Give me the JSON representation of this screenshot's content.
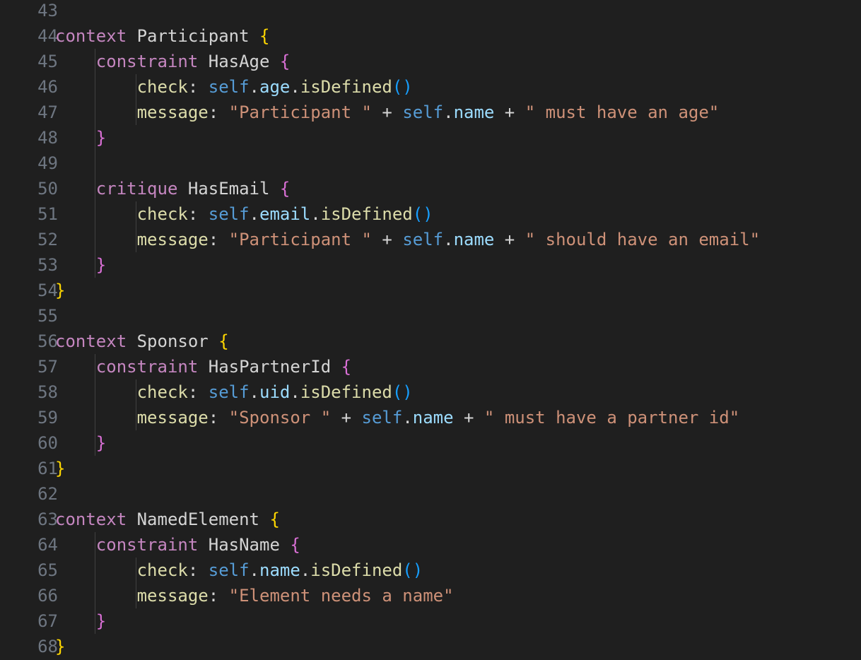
{
  "editor": {
    "colors": {
      "background": "#1f1f1f",
      "line_number": "#6e7681",
      "keyword": "#c586c0",
      "keyword_ctx": "#c586c0",
      "identifier": "#d4d4d4",
      "brace_outer": "#ffd700",
      "brace_inner": "#da70d6",
      "property": "#9cdcfe",
      "self": "#569cd6",
      "method": "#dcdcaa",
      "paren": "#179fff",
      "string": "#ce9178",
      "operator": "#d4d4d4"
    },
    "lines": [
      {
        "n": "43",
        "tokens": []
      },
      {
        "n": "44",
        "tokens": [
          {
            "t": "context",
            "c": "keyword"
          },
          {
            "t": " Participant ",
            "c": "identifier"
          },
          {
            "t": "{",
            "c": "brace_outer"
          }
        ]
      },
      {
        "n": "45",
        "tokens": [
          {
            "t": "    "
          },
          {
            "t": "constraint",
            "c": "keyword"
          },
          {
            "t": " HasAge ",
            "c": "identifier"
          },
          {
            "t": "{",
            "c": "brace_inner"
          }
        ]
      },
      {
        "n": "46",
        "tokens": [
          {
            "t": "        "
          },
          {
            "t": "check",
            "c": "method"
          },
          {
            "t": ": ",
            "c": "operator"
          },
          {
            "t": "self",
            "c": "self"
          },
          {
            "t": ".",
            "c": "operator"
          },
          {
            "t": "age",
            "c": "property"
          },
          {
            "t": ".",
            "c": "operator"
          },
          {
            "t": "isDefined",
            "c": "method"
          },
          {
            "t": "()",
            "c": "paren"
          }
        ]
      },
      {
        "n": "47",
        "tokens": [
          {
            "t": "        "
          },
          {
            "t": "message",
            "c": "method"
          },
          {
            "t": ": ",
            "c": "operator"
          },
          {
            "t": "\"Participant \"",
            "c": "string"
          },
          {
            "t": " + ",
            "c": "operator"
          },
          {
            "t": "self",
            "c": "self"
          },
          {
            "t": ".",
            "c": "operator"
          },
          {
            "t": "name",
            "c": "property"
          },
          {
            "t": " + ",
            "c": "operator"
          },
          {
            "t": "\" must have an age\"",
            "c": "string"
          }
        ]
      },
      {
        "n": "48",
        "tokens": [
          {
            "t": "    "
          },
          {
            "t": "}",
            "c": "brace_inner"
          }
        ]
      },
      {
        "n": "49",
        "tokens": []
      },
      {
        "n": "50",
        "tokens": [
          {
            "t": "    "
          },
          {
            "t": "critique",
            "c": "keyword"
          },
          {
            "t": " HasEmail ",
            "c": "identifier"
          },
          {
            "t": "{",
            "c": "brace_inner"
          }
        ]
      },
      {
        "n": "51",
        "tokens": [
          {
            "t": "        "
          },
          {
            "t": "check",
            "c": "method"
          },
          {
            "t": ": ",
            "c": "operator"
          },
          {
            "t": "self",
            "c": "self"
          },
          {
            "t": ".",
            "c": "operator"
          },
          {
            "t": "email",
            "c": "property"
          },
          {
            "t": ".",
            "c": "operator"
          },
          {
            "t": "isDefined",
            "c": "method"
          },
          {
            "t": "()",
            "c": "paren"
          }
        ]
      },
      {
        "n": "52",
        "tokens": [
          {
            "t": "        "
          },
          {
            "t": "message",
            "c": "method"
          },
          {
            "t": ": ",
            "c": "operator"
          },
          {
            "t": "\"Participant \"",
            "c": "string"
          },
          {
            "t": " + ",
            "c": "operator"
          },
          {
            "t": "self",
            "c": "self"
          },
          {
            "t": ".",
            "c": "operator"
          },
          {
            "t": "name",
            "c": "property"
          },
          {
            "t": " + ",
            "c": "operator"
          },
          {
            "t": "\" should have an email\"",
            "c": "string"
          }
        ]
      },
      {
        "n": "53",
        "tokens": [
          {
            "t": "    "
          },
          {
            "t": "}",
            "c": "brace_inner"
          }
        ]
      },
      {
        "n": "54",
        "tokens": [
          {
            "t": "}",
            "c": "brace_outer"
          }
        ]
      },
      {
        "n": "55",
        "tokens": []
      },
      {
        "n": "56",
        "tokens": [
          {
            "t": "context",
            "c": "keyword"
          },
          {
            "t": " Sponsor ",
            "c": "identifier"
          },
          {
            "t": "{",
            "c": "brace_outer"
          }
        ]
      },
      {
        "n": "57",
        "tokens": [
          {
            "t": "    "
          },
          {
            "t": "constraint",
            "c": "keyword"
          },
          {
            "t": " HasPartnerId ",
            "c": "identifier"
          },
          {
            "t": "{",
            "c": "brace_inner"
          }
        ]
      },
      {
        "n": "58",
        "tokens": [
          {
            "t": "        "
          },
          {
            "t": "check",
            "c": "method"
          },
          {
            "t": ": ",
            "c": "operator"
          },
          {
            "t": "self",
            "c": "self"
          },
          {
            "t": ".",
            "c": "operator"
          },
          {
            "t": "uid",
            "c": "property"
          },
          {
            "t": ".",
            "c": "operator"
          },
          {
            "t": "isDefined",
            "c": "method"
          },
          {
            "t": "()",
            "c": "paren"
          }
        ]
      },
      {
        "n": "59",
        "tokens": [
          {
            "t": "        "
          },
          {
            "t": "message",
            "c": "method"
          },
          {
            "t": ": ",
            "c": "operator"
          },
          {
            "t": "\"Sponsor \"",
            "c": "string"
          },
          {
            "t": " + ",
            "c": "operator"
          },
          {
            "t": "self",
            "c": "self"
          },
          {
            "t": ".",
            "c": "operator"
          },
          {
            "t": "name",
            "c": "property"
          },
          {
            "t": " + ",
            "c": "operator"
          },
          {
            "t": "\" must have a partner id\"",
            "c": "string"
          }
        ]
      },
      {
        "n": "60",
        "tokens": [
          {
            "t": "    "
          },
          {
            "t": "}",
            "c": "brace_inner"
          }
        ]
      },
      {
        "n": "61",
        "tokens": [
          {
            "t": "}",
            "c": "brace_outer"
          }
        ]
      },
      {
        "n": "62",
        "tokens": []
      },
      {
        "n": "63",
        "tokens": [
          {
            "t": "context",
            "c": "keyword"
          },
          {
            "t": " NamedElement ",
            "c": "identifier"
          },
          {
            "t": "{",
            "c": "brace_outer"
          }
        ]
      },
      {
        "n": "64",
        "tokens": [
          {
            "t": "    "
          },
          {
            "t": "constraint",
            "c": "keyword"
          },
          {
            "t": " HasName ",
            "c": "identifier"
          },
          {
            "t": "{",
            "c": "brace_inner"
          }
        ]
      },
      {
        "n": "65",
        "tokens": [
          {
            "t": "        "
          },
          {
            "t": "check",
            "c": "method"
          },
          {
            "t": ": ",
            "c": "operator"
          },
          {
            "t": "self",
            "c": "self"
          },
          {
            "t": ".",
            "c": "operator"
          },
          {
            "t": "name",
            "c": "property"
          },
          {
            "t": ".",
            "c": "operator"
          },
          {
            "t": "isDefined",
            "c": "method"
          },
          {
            "t": "()",
            "c": "paren"
          }
        ]
      },
      {
        "n": "66",
        "tokens": [
          {
            "t": "        "
          },
          {
            "t": "message",
            "c": "method"
          },
          {
            "t": ": ",
            "c": "operator"
          },
          {
            "t": "\"Element needs a name\"",
            "c": "string"
          }
        ]
      },
      {
        "n": "67",
        "tokens": [
          {
            "t": "    "
          },
          {
            "t": "}",
            "c": "brace_inner"
          }
        ]
      },
      {
        "n": "68",
        "tokens": [
          {
            "t": "}",
            "c": "brace_outer"
          }
        ]
      }
    ]
  }
}
